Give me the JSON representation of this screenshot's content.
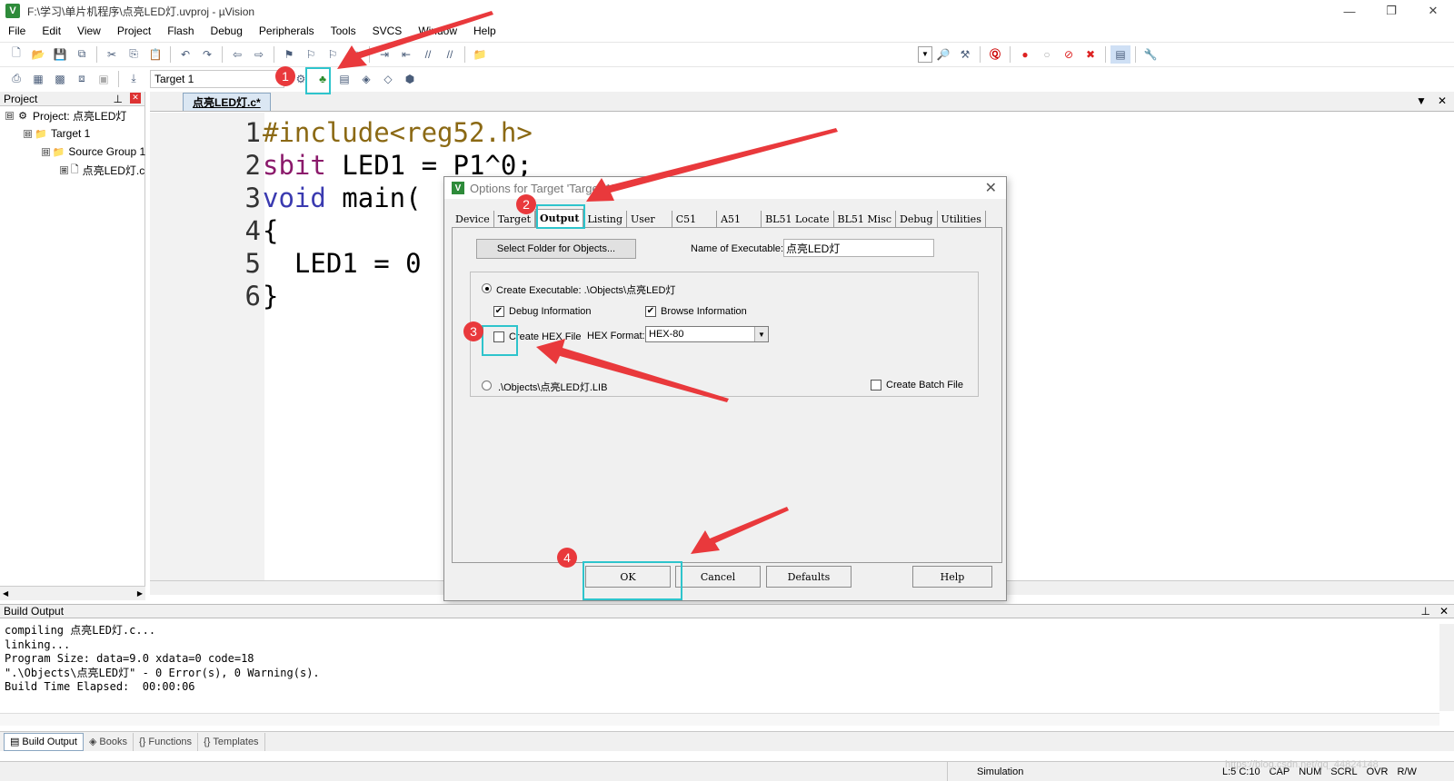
{
  "window": {
    "title": "F:\\学习\\单片机程序\\点亮LED灯.uvproj - µVision",
    "minimize": "—",
    "restore": "❐",
    "close": "✕"
  },
  "menu": [
    "File",
    "Edit",
    "View",
    "Project",
    "Flash",
    "Debug",
    "Peripherals",
    "Tools",
    "SVCS",
    "Window",
    "Help"
  ],
  "toolbar2": {
    "target_select": "Target 1"
  },
  "project_panel": {
    "title": "Project",
    "tree": [
      {
        "label": "Project: 点亮LED灯",
        "expander": "⊟",
        "icon": "project-icon",
        "indent": 0
      },
      {
        "label": "Target 1",
        "expander": "⊟",
        "icon": "target-folder-icon",
        "indent": 1
      },
      {
        "label": "Source Group 1",
        "expander": "⊟",
        "icon": "folder-icon",
        "indent": 2
      },
      {
        "label": "点亮LED灯.c",
        "expander": "⊞",
        "icon": "file-icon",
        "indent": 3
      }
    ]
  },
  "editor": {
    "tab": "点亮LED灯.c*",
    "lines": [
      {
        "num": "1",
        "parts": [
          {
            "t": "#include<reg52.h>",
            "c": "pp"
          }
        ]
      },
      {
        "num": "2",
        "parts": [
          {
            "t": "sbit",
            "c": "type"
          },
          {
            "t": " LED1 = P1^0;",
            "c": "txt"
          }
        ]
      },
      {
        "num": "3",
        "parts": [
          {
            "t": "void",
            "c": "blue"
          },
          {
            "t": " main(",
            "c": "txt"
          }
        ]
      },
      {
        "num": "4",
        "parts": [
          {
            "t": "{",
            "c": "txt"
          }
        ]
      },
      {
        "num": "5",
        "parts": [
          {
            "t": "  LED1 = 0",
            "c": "txt"
          }
        ]
      },
      {
        "num": "6",
        "parts": [
          {
            "t": "}",
            "c": "txt"
          }
        ]
      }
    ]
  },
  "dialog": {
    "title": "Options for Target 'Target 1'",
    "tabs": [
      "Device",
      "Target",
      "Output",
      "Listing",
      "User",
      "C51",
      "A51",
      "BL51 Locate",
      "BL51 Misc",
      "Debug",
      "Utilities"
    ],
    "active_tab": "Output",
    "select_folder_button": "Select Folder for Objects...",
    "name_of_executable_label": "Name of Executable:",
    "name_of_executable_value": "点亮LED灯",
    "create_executable_label": "Create Executable:  .\\Objects\\点亮LED灯",
    "debug_information_label": "Debug Information",
    "debug_information_checked": true,
    "browse_information_label": "Browse Information",
    "browse_information_checked": true,
    "create_hex_label": "Create HEX File",
    "create_hex_checked": false,
    "hex_format_label": "HEX Format:",
    "hex_format_value": "HEX-80",
    "create_library_label": ".\\Objects\\点亮LED灯.LIB",
    "create_batch_label": "Create Batch File",
    "ok": "OK",
    "cancel": "Cancel",
    "defaults": "Defaults",
    "help": "Help"
  },
  "annotations": {
    "step1": "1",
    "step2": "2",
    "step3": "3",
    "step4": "4",
    "highlight_color": "#2ec4cc",
    "arrow_color": "#e9393c"
  },
  "build_output": {
    "title": "Build Output",
    "lines": [
      "compiling 点亮LED灯.c...",
      "linking...",
      "Program Size: data=9.0 xdata=0 code=18",
      "\".\\Objects\\点亮LED灯\" - 0 Error(s), 0 Warning(s).",
      "Build Time Elapsed:  00:00:06"
    ]
  },
  "bottom_tabs": [
    "Build Output",
    "Books",
    "Functions",
    "Templates"
  ],
  "status": {
    "mode": "Simulation",
    "position": "L:5 C:10",
    "caps": "CAP",
    "num": "NUM",
    "scrl": "SCRL",
    "ovr": "OVR",
    "rw": "R/W"
  },
  "watermark": "https://blog.csdn.net/qq_44824148"
}
